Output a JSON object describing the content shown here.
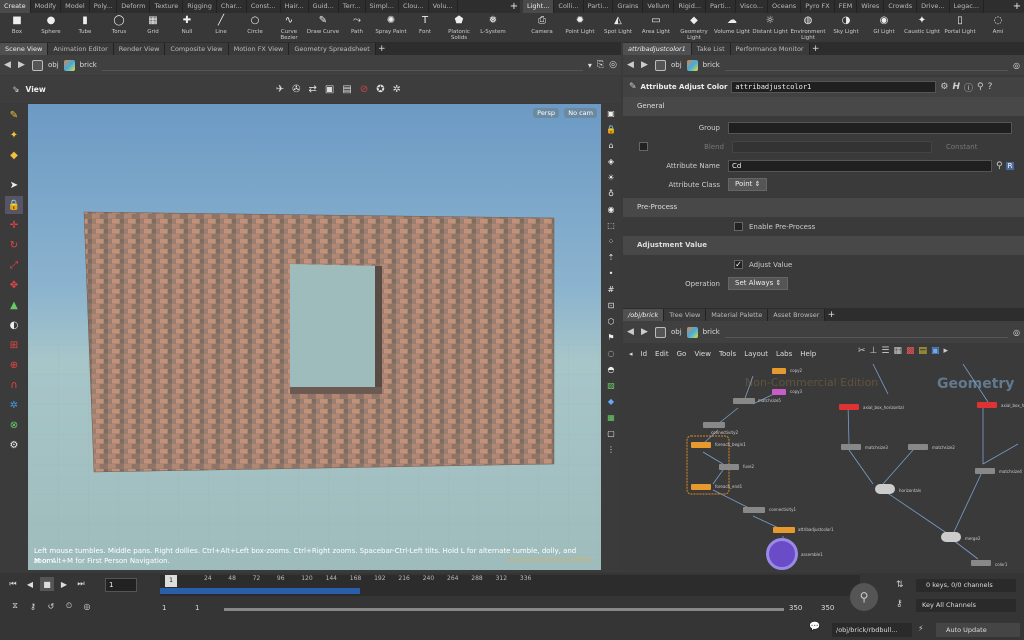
{
  "shelf": {
    "left_tabs": [
      "Create",
      "Modify",
      "Model",
      "Poly...",
      "Deform",
      "Texture",
      "Rigging",
      "Char...",
      "Const...",
      "Hair...",
      "Guid...",
      "Terr...",
      "Simpl...",
      "Clou...",
      "Volu..."
    ],
    "right_tabs": [
      "Light...",
      "Colli...",
      "Parti...",
      "Grains",
      "Vellum",
      "Rigid...",
      "Parti...",
      "Visco...",
      "Oceans",
      "Pyro FX",
      "FEM",
      "Wires",
      "Crowds",
      "Drive...",
      "Legac..."
    ],
    "left_tools": [
      {
        "label": "Box",
        "icon": "box-icon"
      },
      {
        "label": "Sphere",
        "icon": "sphere-icon"
      },
      {
        "label": "Tube",
        "icon": "tube-icon"
      },
      {
        "label": "Torus",
        "icon": "torus-icon"
      },
      {
        "label": "Grid",
        "icon": "grid-icon"
      },
      {
        "label": "Null",
        "icon": "null-icon"
      },
      {
        "label": "Line",
        "icon": "line-icon"
      },
      {
        "label": "Circle",
        "icon": "circle-icon"
      },
      {
        "label": "Curve Bezier",
        "icon": "curve-bezier-icon"
      },
      {
        "label": "Draw Curve",
        "icon": "draw-curve-icon"
      },
      {
        "label": "Path",
        "icon": "path-icon"
      },
      {
        "label": "Spray Paint",
        "icon": "spray-paint-icon"
      },
      {
        "label": "Font",
        "icon": "font-icon"
      },
      {
        "label": "Platonic Solids",
        "icon": "platonic-solids-icon"
      },
      {
        "label": "L-System",
        "icon": "l-system-icon"
      }
    ],
    "right_tools": [
      {
        "label": "Camera",
        "icon": "camera-icon"
      },
      {
        "label": "Point Light",
        "icon": "point-light-icon"
      },
      {
        "label": "Spot Light",
        "icon": "spot-light-icon"
      },
      {
        "label": "Area Light",
        "icon": "area-light-icon"
      },
      {
        "label": "Geometry Light",
        "icon": "geometry-light-icon"
      },
      {
        "label": "Volume Light",
        "icon": "volume-light-icon"
      },
      {
        "label": "Distant Light",
        "icon": "distant-light-icon"
      },
      {
        "label": "Environment Light",
        "icon": "environment-light-icon"
      },
      {
        "label": "Sky Light",
        "icon": "sky-light-icon"
      },
      {
        "label": "GI Light",
        "icon": "gi-light-icon"
      },
      {
        "label": "Caustic Light",
        "icon": "caustic-light-icon"
      },
      {
        "label": "Portal Light",
        "icon": "portal-light-icon"
      },
      {
        "label": "Ami",
        "icon": "ambient-light-icon"
      }
    ]
  },
  "left_pane": {
    "tabs": [
      "Scene View",
      "Animation Editor",
      "Render View",
      "Composite View",
      "Motion FX View",
      "Geometry Spreadsheet"
    ],
    "path": [
      "obj",
      "brick"
    ],
    "view_label": "View",
    "persp": "Persp",
    "cam": "No cam",
    "help_text": "Left mouse tumbles. Middle pans. Right dollies. Ctrl+Alt+Left box-zooms. Ctrl+Right zooms. Spacebar-Ctrl-Left tilts. Hold L for alternate tumble, dolly, and zoom.",
    "help_text2": "M or Alt+M for First Person Navigation.",
    "watermark": "Non-Commercial Edition"
  },
  "param_pane": {
    "tabs": [
      "attribadjustcolor1",
      "Take List",
      "Performance Monitor"
    ],
    "path": [
      "obj",
      "brick"
    ],
    "node_type": "Attribute Adjust Color",
    "node_name": "attribadjustcolor1",
    "sections": {
      "general": "General",
      "preprocess": "Pre-Process",
      "adjust": "Adjustment Value"
    },
    "group_label": "Group",
    "blend_label": "Blend",
    "blend_value": "Constant",
    "attr_name_label": "Attribute Name",
    "attr_name_value": "Cd",
    "attr_class_label": "Attribute Class",
    "attr_class_value": "Point",
    "enable_preprocess": "Enable Pre-Process",
    "adjust_value": "Adjust Value",
    "operation_label": "Operation",
    "operation_value": "Set Always",
    "r_btn": "R"
  },
  "net_pane": {
    "tabs": [
      "/obj/brick",
      "Tree View",
      "Material Palette",
      "Asset Browser"
    ],
    "path": [
      "obj",
      "brick"
    ],
    "menu": [
      "Id",
      "Edit",
      "Go",
      "View",
      "Tools",
      "Layout",
      "Labs",
      "Help"
    ],
    "watermark1": "Non-Commercial Edition",
    "watermark2": "Geometry",
    "nodes": [
      "copy2",
      "copy3",
      "matchsize5",
      "connectivity2",
      "foreach_begin1",
      "foreach_end1",
      "fuse2",
      "connectivity1",
      "attribadjustcolor1",
      "assemble1",
      "axial_box_horizontal",
      "axial_box_ho",
      "matchsize3",
      "matchsize2",
      "matchsize4",
      "horizontals",
      "merge1",
      "merge2",
      "color1",
      "null1"
    ]
  },
  "timeline": {
    "frame": "1",
    "ticks": [
      "24",
      "48",
      "72",
      "96",
      "120",
      "144",
      "168",
      "192",
      "216",
      "240",
      "264",
      "288",
      "312",
      "336"
    ],
    "start1": "1",
    "start2": "1",
    "end1": "350",
    "end2": "350",
    "keys": "0 keys, 0/0 channels",
    "key_all": "Key All Channels",
    "status_path": "/obj/brick/rbdbull...",
    "auto_update": "Auto Update"
  }
}
